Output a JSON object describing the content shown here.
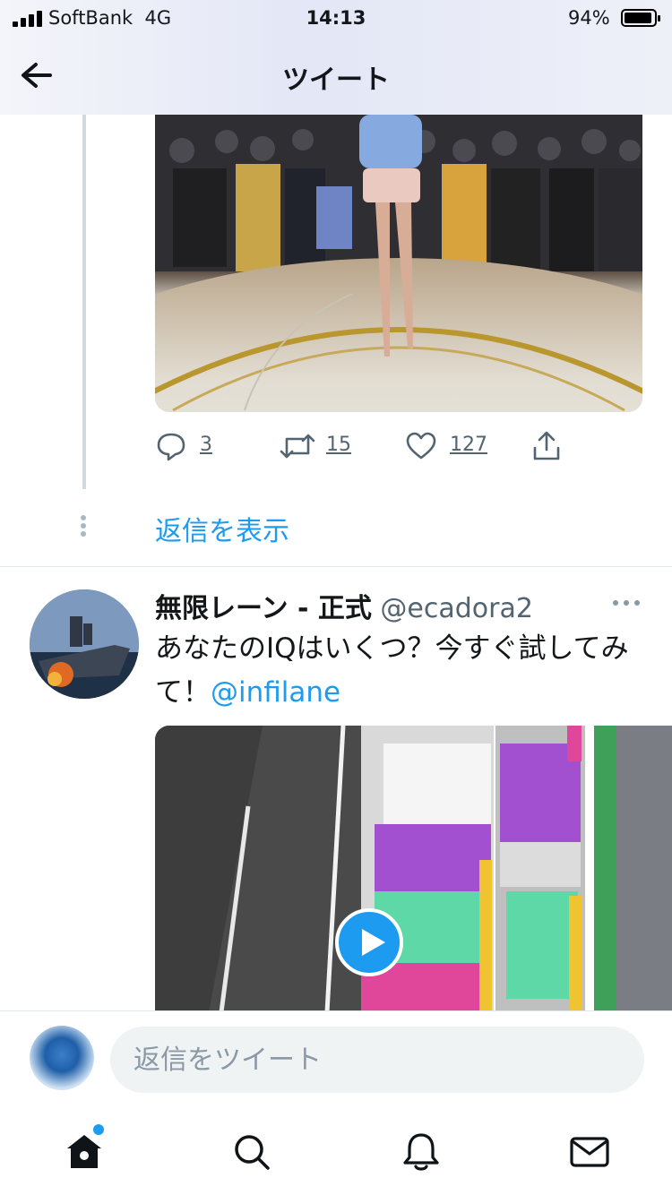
{
  "status_bar": {
    "carrier": "SoftBank",
    "network": "4G",
    "time": "14:13",
    "battery_percent": "94%"
  },
  "header": {
    "title": "ツイート",
    "back_icon": "arrow-left-icon"
  },
  "tweet1": {
    "actions": {
      "reply_count": "3",
      "retweet_count": "15",
      "like_count": "127"
    },
    "icons": [
      "reply-icon",
      "retweet-icon",
      "like-icon",
      "share-icon"
    ]
  },
  "show_replies_label": "返信を表示",
  "tweet2": {
    "display_name": "無限レーン - 正式",
    "handle": "@ecadora2",
    "text": "あなたのIQはいくつ？今すぐ試してみて！",
    "mention": "@infilane"
  },
  "compose": {
    "placeholder": "返信をツイート"
  },
  "tab_bar": {
    "tabs": [
      "home-icon",
      "search-icon",
      "notifications-icon",
      "messages-icon"
    ]
  },
  "colors": {
    "accent": "#1d9bf0",
    "secondary_text": "#536471",
    "primary_text": "#14171a"
  }
}
